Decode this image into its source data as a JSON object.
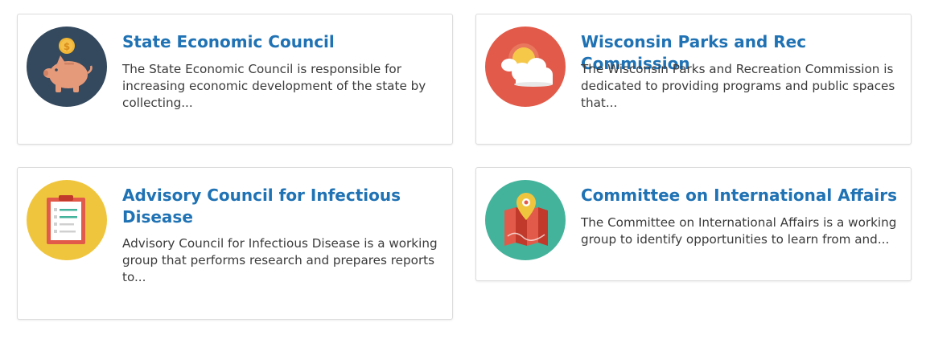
{
  "cards": [
    {
      "title": "State Economic Council",
      "description": "The State Economic Council is responsible for increasing economic development of the state by collecting...",
      "icon": "piggy-bank-icon",
      "icon_bg": "#34495e"
    },
    {
      "title": "Wisconsin Parks and Rec Commission",
      "description": "The Wisconsin Parks and Recreation Commission is dedicated to providing programs and public spaces that...",
      "icon": "sun-cloud-icon",
      "icon_bg": "#e25b4a"
    },
    {
      "title": "Advisory Council for Infectious Disease",
      "description": "Advisory Council for Infectious Disease is a working group that performs research and prepares reports to...",
      "icon": "clipboard-icon",
      "icon_bg": "#f0c53e"
    },
    {
      "title": "Committee on International Affairs",
      "description": "The Committee on International Affairs is a working group to identify opportunities to learn from and...",
      "icon": "map-pin-icon",
      "icon_bg": "#44b39b"
    }
  ],
  "colors": {
    "title": "#1f72b4",
    "text": "#3b3b3b",
    "border": "#dcdcdc"
  }
}
